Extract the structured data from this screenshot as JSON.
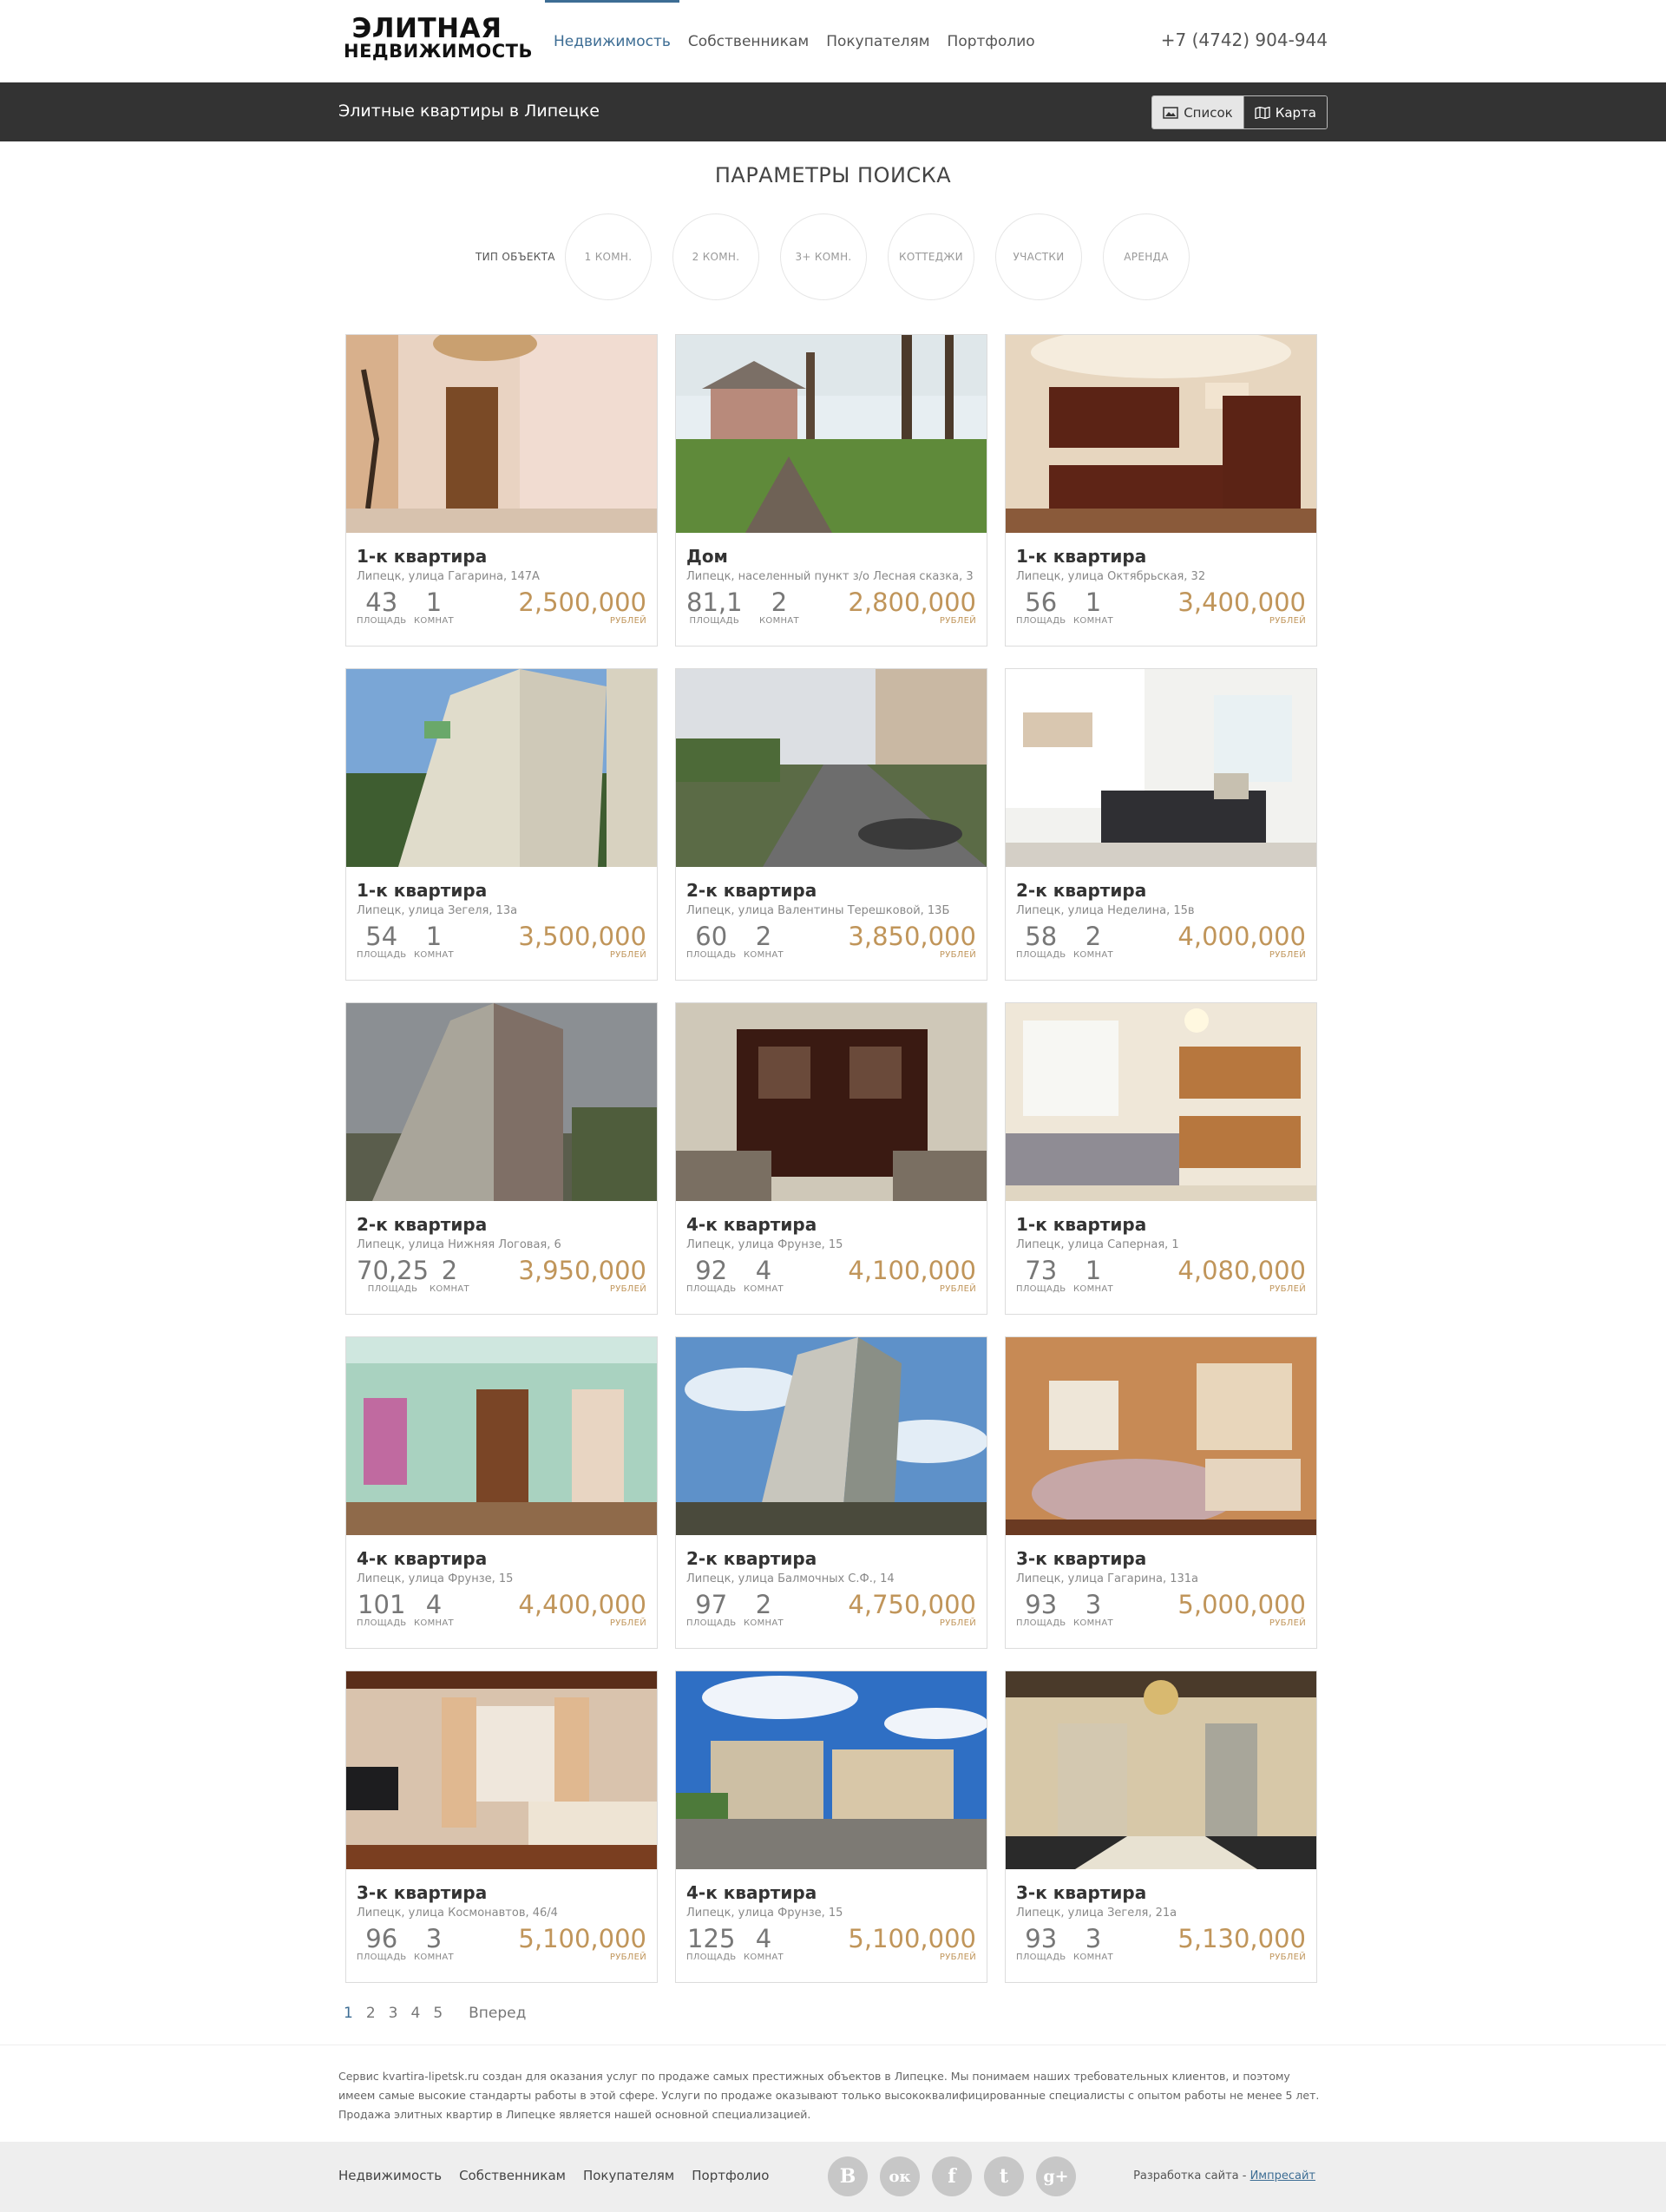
{
  "logo": {
    "line1": "ЭЛИТНАЯ",
    "line2": "НЕДВИЖИМОСТЬ"
  },
  "nav": [
    {
      "label": "Недвижимость",
      "active": true
    },
    {
      "label": "Собственникам"
    },
    {
      "label": "Покупателям"
    },
    {
      "label": "Портфолио"
    }
  ],
  "phone": "+7 (4742) 904-944",
  "bar": {
    "title": "Элитные квартиры в Липецке",
    "list_label": "Список",
    "map_label": "Карта"
  },
  "search": {
    "title": "ПАРАМЕТРЫ ПОИСКА",
    "type_label": "ТИП ОБЪЕКТА",
    "filters": [
      "1 КОМН.",
      "2 КОМН.",
      "3+ КОМН.",
      "КОТТЕДЖИ",
      "УЧАСТКИ",
      "АРЕНДА"
    ]
  },
  "labels": {
    "area": "ПЛОЩАДЬ",
    "rooms": "КОМНАТ",
    "currency": "РУБЛЕЙ"
  },
  "listings": [
    {
      "title": "1-к квартира",
      "address": "Липецк, улица Гагарина, 147А",
      "area": "43",
      "rooms": "1",
      "price": "2,500,000",
      "scene": "hall"
    },
    {
      "title": "Дом",
      "address": "Липецк, населенный пункт з/о Лесная сказка, 3",
      "area": "81,1",
      "rooms": "2",
      "price": "2,800,000",
      "scene": "house"
    },
    {
      "title": "1-к квартира",
      "address": "Липецк, улица Октябрьская, 32",
      "area": "56",
      "rooms": "1",
      "price": "3,400,000",
      "scene": "kitchen-dark"
    },
    {
      "title": "1-к квартира",
      "address": "Липецк, улица Зегеля, 13а",
      "area": "54",
      "rooms": "1",
      "price": "3,500,000",
      "scene": "tower"
    },
    {
      "title": "2-к квартира",
      "address": "Липецк, улица Валентины Терешковой, 13Б",
      "area": "60",
      "rooms": "2",
      "price": "3,850,000",
      "scene": "street"
    },
    {
      "title": "2-к квартира",
      "address": "Липецк, улица Неделина, 15в",
      "area": "58",
      "rooms": "2",
      "price": "4,000,000",
      "scene": "white-room"
    },
    {
      "title": "2-к квартира",
      "address": "Липецк, улица Нижняя Логовая, 6",
      "area": "70,25",
      "rooms": "2",
      "price": "3,950,000",
      "scene": "tower-gray"
    },
    {
      "title": "4-к квартира",
      "address": "Липецк, улица Фрунзе, 15",
      "area": "92",
      "rooms": "4",
      "price": "4,100,000",
      "scene": "cabinet"
    },
    {
      "title": "1-к квартира",
      "address": "Липецк, улица Саперная, 1",
      "area": "73",
      "rooms": "1",
      "price": "4,080,000",
      "scene": "kitchen-light"
    },
    {
      "title": "4-к квартира",
      "address": "Липецк, улица Фрунзе, 15",
      "area": "101",
      "rooms": "4",
      "price": "4,400,000",
      "scene": "mint-room"
    },
    {
      "title": "2-к квартира",
      "address": "Липецк, улица Балмочных С.Ф., 14",
      "area": "97",
      "rooms": "2",
      "price": "4,750,000",
      "scene": "tower-blue"
    },
    {
      "title": "3-к квартира",
      "address": "Липецк, улица Гагарина, 131а",
      "area": "93",
      "rooms": "3",
      "price": "5,000,000",
      "scene": "kitchen-orange"
    },
    {
      "title": "3-к квартира",
      "address": "Липецк, улица Космонавтов, 46/4",
      "area": "96",
      "rooms": "3",
      "price": "5,100,000",
      "scene": "living"
    },
    {
      "title": "4-к квартира",
      "address": "Липецк, улица Фрунзе, 15",
      "area": "125",
      "rooms": "4",
      "price": "5,100,000",
      "scene": "buildings"
    },
    {
      "title": "3-к квартира",
      "address": "Липецк, улица Зегеля, 21а",
      "area": "93",
      "rooms": "3",
      "price": "5,130,000",
      "scene": "hall-chandelier"
    }
  ],
  "pagination": {
    "pages": [
      "1",
      "2",
      "3",
      "4",
      "5"
    ],
    "current": "1",
    "next": "Вперед"
  },
  "about": "Сервис kvartira-lipetsk.ru создан для оказания услуг по продаже самых престижных объектов в Липецке. Мы понимаем наших требовательных клиентов, и поэтому имеем самые высокие стандарты работы в этой сфере. Услуги по продаже оказывают только высококвалифицированные специалисты с опытом работы не менее 5 лет. Продажа элитных квартир в Липецке является нашей основной специализацией.",
  "footer": {
    "nav": [
      "Недвижимость",
      "Собственникам",
      "Покупателям",
      "Портфолио"
    ],
    "socials": [
      {
        "name": "vk",
        "glyph": "В"
      },
      {
        "name": "odnoklassniki",
        "glyph": "ок"
      },
      {
        "name": "facebook",
        "glyph": "f"
      },
      {
        "name": "twitter",
        "glyph": "t"
      },
      {
        "name": "google-plus",
        "glyph": "g+"
      }
    ],
    "dev_text": "Разработка сайта - ",
    "dev_link": "Импресайт"
  },
  "colors": {
    "accent": "#3d6d94",
    "price": "#c0955a",
    "bar": "#333333",
    "footer": "#eeeeee"
  }
}
